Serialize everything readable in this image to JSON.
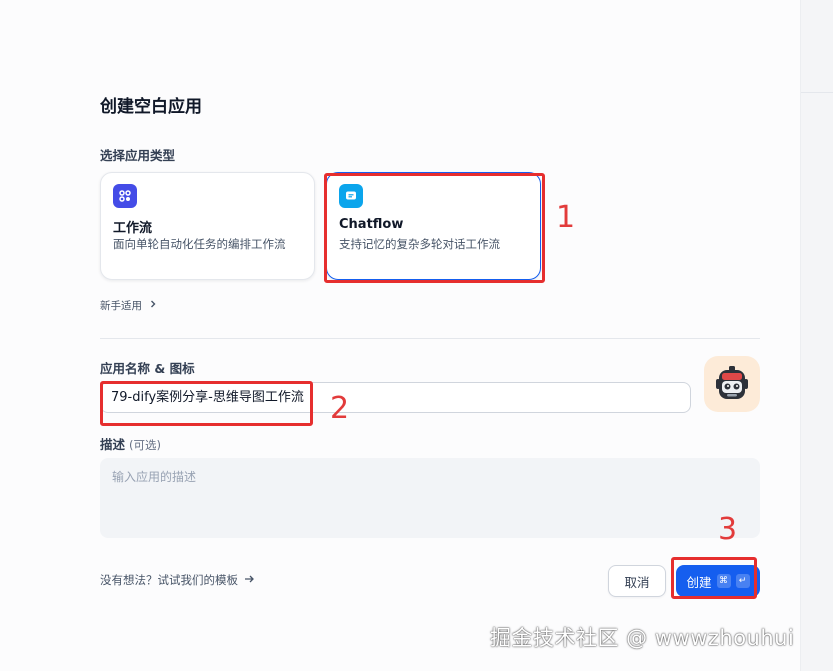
{
  "dialog": {
    "title": "创建空白应用",
    "type_section_label": "选择应用类型",
    "app_types": [
      {
        "name": "工作流",
        "description": "面向单轮自动化任务的编排工作流",
        "icon": "workflow-icon",
        "selected": false
      },
      {
        "name": "Chatflow",
        "description": "支持记忆的复杂多轮对话工作流",
        "icon": "chatflow-icon",
        "selected": true
      }
    ],
    "beginner_link": "新手适用",
    "name_icon_label": "应用名称 & 图标",
    "app_name_value": "79-dify案例分享-思维导图工作流",
    "avatar_icon": "robot-icon",
    "description_label": "描述",
    "description_optional": "(可选)",
    "description_placeholder": "输入应用的描述",
    "templates_link": "没有想法？试试我们的模板",
    "cancel_label": "取消",
    "create_label": "创建",
    "create_shortcut_keys": [
      "⌘",
      "↵"
    ]
  },
  "annotations": [
    "1",
    "2",
    "3"
  ],
  "watermark": "掘金技术社区 @ wwwzhouhui",
  "colors": {
    "primary": "#155eef",
    "highlight": "#e62e2e",
    "workflow_icon_bg": "#444ce7",
    "chatflow_icon_bg": "#0ba5ec"
  }
}
